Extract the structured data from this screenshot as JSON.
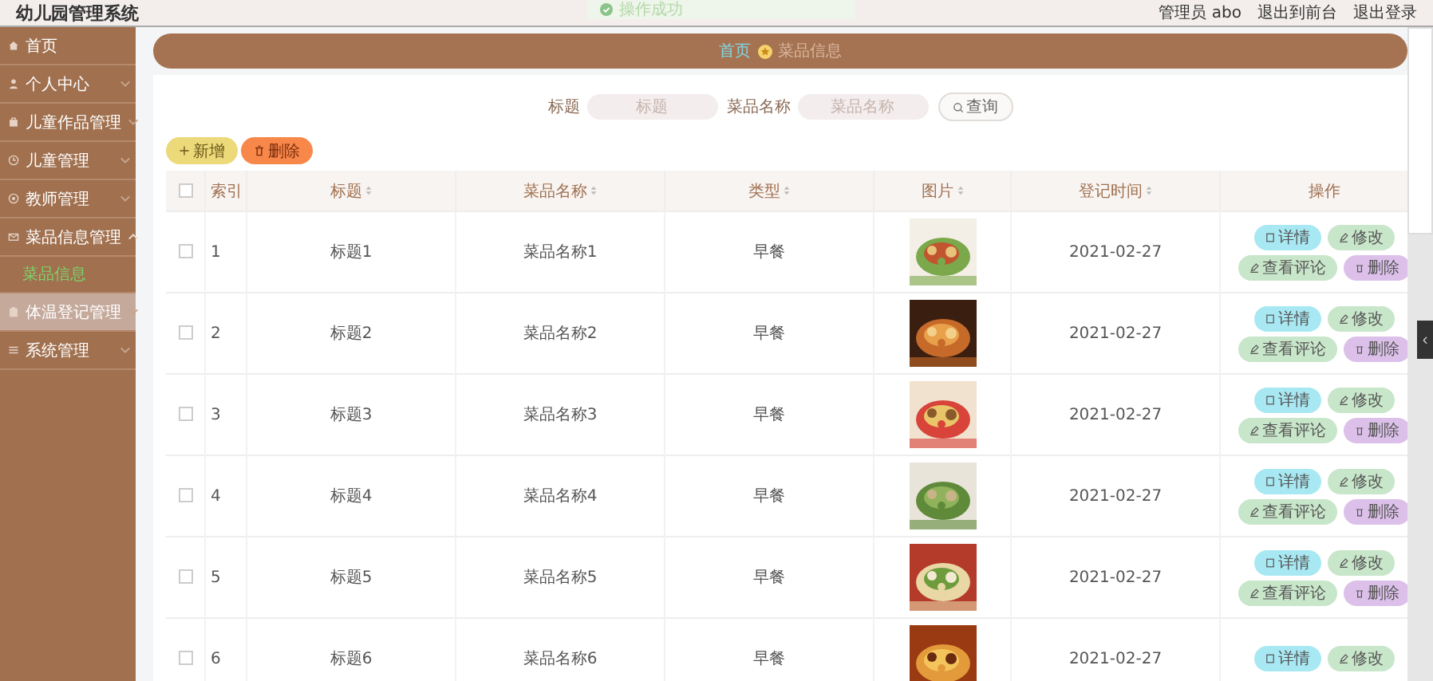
{
  "header": {
    "title": "幼儿园管理系统",
    "toast": "操作成功",
    "user": "管理员 abo",
    "links": [
      "退出到前台",
      "退出登录"
    ]
  },
  "sidebar": {
    "items": [
      {
        "label": "首页",
        "has_arrow": false,
        "hovered": false
      },
      {
        "label": "个人中心",
        "has_arrow": true,
        "expanded": false,
        "hovered": false
      },
      {
        "label": "儿童作品管理",
        "has_arrow": true,
        "expanded": false,
        "hovered": false
      },
      {
        "label": "儿童管理",
        "has_arrow": true,
        "expanded": false,
        "hovered": false
      },
      {
        "label": "教师管理",
        "has_arrow": true,
        "expanded": false,
        "hovered": false
      },
      {
        "label": "菜品信息管理",
        "has_arrow": true,
        "expanded": true,
        "hovered": false,
        "children": [
          {
            "label": "菜品信息",
            "selected": true
          }
        ]
      },
      {
        "label": "体温登记管理",
        "has_arrow": true,
        "expanded": false,
        "hovered": true
      },
      {
        "label": "系统管理",
        "has_arrow": true,
        "expanded": false,
        "hovered": false
      }
    ]
  },
  "breadcrumb": [
    {
      "label": "首页",
      "selected": false
    },
    {
      "label": "菜品信息",
      "selected": true
    }
  ],
  "search": {
    "fields": [
      {
        "label": "标题",
        "placeholder": "标题"
      },
      {
        "label": "菜品名称",
        "placeholder": "菜品名称"
      }
    ],
    "button": "查询"
  },
  "toolbar": [
    {
      "label": "新增",
      "kind": "add"
    },
    {
      "label": "删除",
      "kind": "delete"
    }
  ],
  "table": {
    "select_all_checked": false,
    "columns": [
      {
        "label": "索引",
        "sortable": false
      },
      {
        "label": "标题",
        "sortable": true
      },
      {
        "label": "菜品名称",
        "sortable": true
      },
      {
        "label": "类型",
        "sortable": true
      },
      {
        "label": "图片",
        "sortable": true
      },
      {
        "label": "登记时间",
        "sortable": true
      },
      {
        "label": "操作",
        "sortable": false
      }
    ],
    "rows": [
      {
        "checked": false,
        "index": "1",
        "title": "标题1",
        "name": "菜品名称1",
        "type": "早餐",
        "date": "2021-02-27",
        "actions": [
          {
            "label": "详情",
            "kind": "detail"
          },
          {
            "label": "修改",
            "kind": "edit"
          },
          {
            "label": "查看评论",
            "kind": "comment"
          },
          {
            "label": "删除",
            "kind": "delete"
          }
        ]
      },
      {
        "checked": false,
        "index": "2",
        "title": "标题2",
        "name": "菜品名称2",
        "type": "早餐",
        "date": "2021-02-27",
        "actions": [
          {
            "label": "详情",
            "kind": "detail"
          },
          {
            "label": "修改",
            "kind": "edit"
          },
          {
            "label": "查看评论",
            "kind": "comment"
          },
          {
            "label": "删除",
            "kind": "delete"
          }
        ]
      },
      {
        "checked": false,
        "index": "3",
        "title": "标题3",
        "name": "菜品名称3",
        "type": "早餐",
        "date": "2021-02-27",
        "actions": [
          {
            "label": "详情",
            "kind": "detail"
          },
          {
            "label": "修改",
            "kind": "edit"
          },
          {
            "label": "查看评论",
            "kind": "comment"
          },
          {
            "label": "删除",
            "kind": "delete"
          }
        ]
      },
      {
        "checked": false,
        "index": "4",
        "title": "标题4",
        "name": "菜品名称4",
        "type": "早餐",
        "date": "2021-02-27",
        "actions": [
          {
            "label": "详情",
            "kind": "detail"
          },
          {
            "label": "修改",
            "kind": "edit"
          },
          {
            "label": "查看评论",
            "kind": "comment"
          },
          {
            "label": "删除",
            "kind": "delete"
          }
        ]
      },
      {
        "checked": false,
        "index": "5",
        "title": "标题5",
        "name": "菜品名称5",
        "type": "早餐",
        "date": "2021-02-27",
        "actions": [
          {
            "label": "详情",
            "kind": "detail"
          },
          {
            "label": "修改",
            "kind": "edit"
          },
          {
            "label": "查看评论",
            "kind": "comment"
          },
          {
            "label": "删除",
            "kind": "delete"
          }
        ]
      },
      {
        "checked": false,
        "index": "6",
        "title": "标题6",
        "name": "菜品名称6",
        "type": "早餐",
        "date": "2021-02-27",
        "actions": [
          {
            "label": "详情",
            "kind": "detail"
          },
          {
            "label": "修改",
            "kind": "edit"
          }
        ]
      }
    ]
  },
  "side_tab": "‹"
}
